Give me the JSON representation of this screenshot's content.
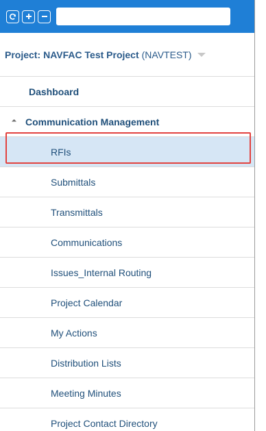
{
  "toolbar": {
    "refresh_icon": "refresh-icon",
    "expand_all_icon": "plus-icon",
    "collapse_all_icon": "minus-icon",
    "search_value": "",
    "search_placeholder": ""
  },
  "project": {
    "label": "Project:",
    "name": "NAVFAC Test Project",
    "code": "(NAVTEST)"
  },
  "nav": {
    "dashboard": "Dashboard",
    "group": {
      "label": "Communication Management",
      "items": [
        "RFIs",
        "Submittals",
        "Transmittals",
        "Communications",
        "Issues_Internal Routing",
        "Project Calendar",
        "My Actions",
        "Distribution Lists",
        "Meeting Minutes",
        "Project Contact Directory"
      ],
      "selected": "RFIs"
    }
  },
  "colors": {
    "toolbar_bg": "#1f7fd6",
    "selected_bg": "#d6e6f5",
    "selected_outline": "#e2413e",
    "nav_text": "#1f4f7a"
  }
}
